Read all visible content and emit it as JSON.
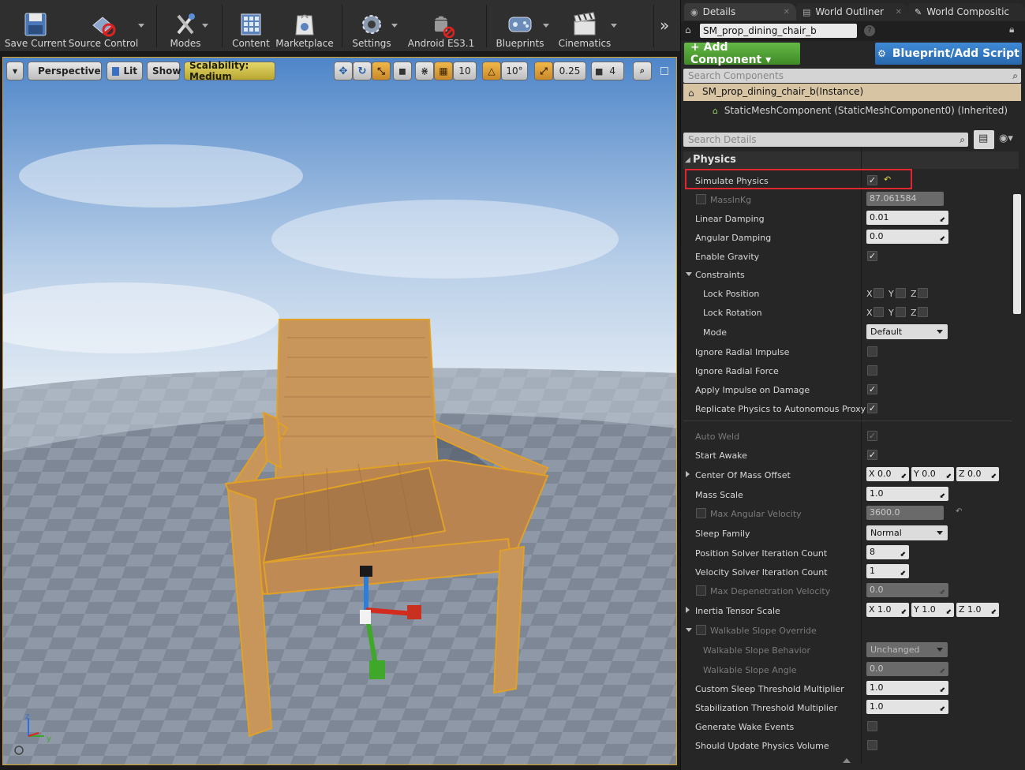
{
  "toolbar": {
    "buttons": [
      {
        "label": "Save Current",
        "icon": "save-icon"
      },
      {
        "label": "Source Control",
        "icon": "source-control-icon"
      },
      {
        "label": "Modes",
        "icon": "modes-icon"
      },
      {
        "label": "Content",
        "icon": "content-icon"
      },
      {
        "label": "Marketplace",
        "icon": "marketplace-icon"
      },
      {
        "label": "Settings",
        "icon": "settings-icon"
      },
      {
        "label": "Android ES3.1",
        "icon": "android-icon"
      },
      {
        "label": "Blueprints",
        "icon": "blueprints-icon"
      },
      {
        "label": "Cinematics",
        "icon": "cinematics-icon"
      }
    ],
    "overflow": "»"
  },
  "viewport": {
    "menu_caret": "▾",
    "perspective": "Perspective",
    "lit": "Lit",
    "show": "Show",
    "scalability": "Scalability: Medium",
    "grid_snap": "10",
    "rotation_snap": "10°",
    "scale_snap": "0.25",
    "camera_speed": "4"
  },
  "details": {
    "tabs": [
      {
        "label": "Details",
        "active": true
      },
      {
        "label": "World Outliner",
        "active": false
      },
      {
        "label": "World Compositic",
        "active": false
      }
    ],
    "actor_name": "SM_prop_dining_chair_b",
    "add_component": "+ Add Component ▾",
    "blueprint_script": "Blueprint/Add Script",
    "search_components": "Search Components",
    "components": {
      "instance": "SM_prop_dining_chair_b(Instance)",
      "static_mesh": "StaticMeshComponent (StaticMeshComponent0) (Inherited)"
    },
    "search_details": "Search Details",
    "section": "Physics",
    "props": {
      "simulate_physics": "Simulate Physics",
      "mass": "MassInKg",
      "mass_val": "87.061584",
      "linear_damping": "Linear Damping",
      "linear_damping_val": "0.01",
      "angular_damping": "Angular Damping",
      "angular_damping_val": "0.0",
      "enable_gravity": "Enable Gravity",
      "constraints": "Constraints",
      "lock_position": "Lock Position",
      "lock_rotation": "Lock Rotation",
      "mode": "Mode",
      "mode_val": "Default",
      "ignore_radial_impulse": "Ignore Radial Impulse",
      "ignore_radial_force": "Ignore Radial Force",
      "apply_impulse": "Apply Impulse on Damage",
      "replicate_physics": "Replicate Physics to Autonomous Proxy",
      "auto_weld": "Auto Weld",
      "start_awake": "Start Awake",
      "com_offset": "Center Of Mass Offset",
      "com_x": "0.0",
      "com_y": "0.0",
      "com_z": "0.0",
      "mass_scale": "Mass Scale",
      "mass_scale_val": "1.0",
      "max_ang_vel": "Max Angular Velocity",
      "max_ang_vel_val": "3600.0",
      "sleep_family": "Sleep Family",
      "sleep_family_val": "Normal",
      "pos_solver": "Position Solver Iteration Count",
      "pos_solver_val": "8",
      "vel_solver": "Velocity Solver Iteration Count",
      "vel_solver_val": "1",
      "max_depen": "Max Depenetration Velocity",
      "max_depen_val": "0.0",
      "inertia": "Inertia Tensor Scale",
      "in_x": "1.0",
      "in_y": "1.0",
      "in_z": "1.0",
      "walkable_override": "Walkable Slope Override",
      "walkable_behavior": "Walkable Slope Behavior",
      "walkable_behavior_val": "Unchanged",
      "walkable_angle": "Walkable Slope Angle",
      "walkable_angle_val": "0.0",
      "custom_sleep": "Custom Sleep Threshold Multiplier",
      "custom_sleep_val": "1.0",
      "stabilization": "Stabilization Threshold Multiplier",
      "stabilization_val": "1.0",
      "wake_events": "Generate Wake Events",
      "update_volume": "Should Update Physics Volume"
    },
    "axis_x": "X",
    "axis_y": "Y",
    "axis_z": "Z"
  },
  "colors": {
    "selection_highlight": "#e0262e",
    "add_component": "#4c9a30",
    "blueprint_button": "#2f74bf",
    "selected_outline": "#d6a21e"
  }
}
